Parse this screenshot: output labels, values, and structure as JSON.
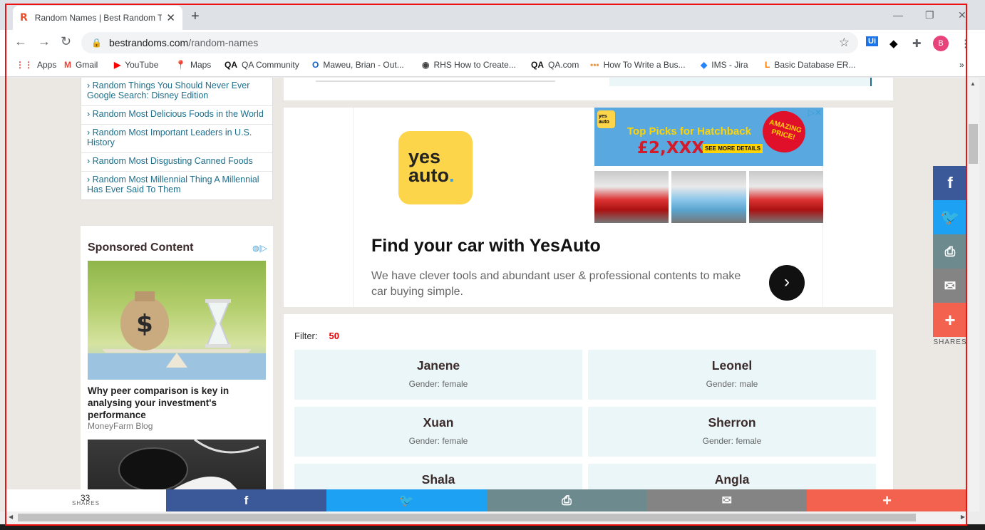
{
  "browser": {
    "tab_title": "Random Names | Best Random T",
    "tab_favicon": "R",
    "url_domain": "bestrandoms.com",
    "url_path": "/random-names",
    "bookmarks": [
      "Apps",
      "Gmail",
      "YouTube",
      "Maps",
      "QA Community",
      "Maweu, Brian - Out...",
      "RHS How to Create...",
      "QA.com",
      "How To Write a Bus...",
      "IMS - Jira",
      "Basic Database ER..."
    ],
    "profile_initial": "B"
  },
  "sidebar_links": [
    "› Random Things You Should Never Ever Google Search: Disney Edition",
    "› Random Most Delicious Foods in the World",
    "› Random Most Important Leaders in U.S. History",
    "› Random Most Disgusting Canned Foods",
    "› Random Most Millennial Thing A Millennial Has Ever Said To Them"
  ],
  "sponsored": {
    "heading": "Sponsored Content",
    "article_title": "Why peer comparison is key in analysing your investment's performance",
    "article_source": "MoneyFarm Blog"
  },
  "ad": {
    "logo_line1": "yes",
    "logo_line2": "auto",
    "banner_headline": "Top Picks for Hatchback",
    "banner_price": "£2,XXX",
    "banner_button": "SEE MORE DETAILS",
    "banner_burst": "AMAZING PRICE!",
    "title": "Find your car with YesAuto",
    "description": "We have clever tools and abundant user & professional contents to make car buying simple."
  },
  "names": {
    "filter_label": "Filter:",
    "filter_value": "50",
    "items": [
      {
        "name": "Janene",
        "gender": "Gender: female"
      },
      {
        "name": "Leonel",
        "gender": "Gender: male"
      },
      {
        "name": "Xuan",
        "gender": "Gender: female"
      },
      {
        "name": "Sherron",
        "gender": "Gender: female"
      },
      {
        "name": "Shala",
        "gender": ""
      },
      {
        "name": "Angla",
        "gender": ""
      }
    ]
  },
  "share": {
    "count": "33",
    "label": "SHARES",
    "colors": {
      "facebook": "#3b5998",
      "twitter": "#1da1f2",
      "print": "#6d8b8f",
      "email": "#848484",
      "more": "#f2624f"
    }
  }
}
